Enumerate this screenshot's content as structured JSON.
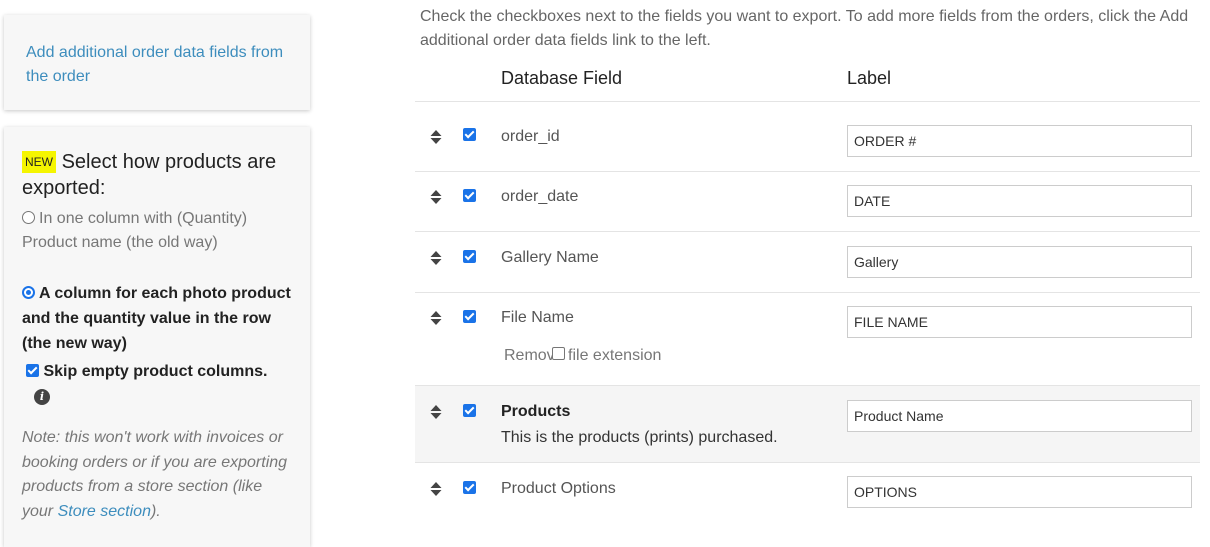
{
  "sidebar": {
    "links_panel": {
      "add_fields_link": "Add additional order data fields from the order"
    },
    "export_panel": {
      "badge": "NEW",
      "heading": "Select how products are exported:",
      "option_old": "In one column with (Quantity) Product name (the old way)",
      "option_new": "A column for each photo product and the quantity value in the row (the new way)",
      "skip_empty": "Skip empty product columns.",
      "note_prefix": "Note: this won't work with invoices or booking orders or if you are exporting products from a store section (like your ",
      "note_link": "Store section",
      "note_suffix": ")."
    }
  },
  "main": {
    "intro": "Check the checkboxes next to the fields you want to export. To add more fields from the orders, click the Add additional order data fields link to the left.",
    "columns": {
      "field": "Database Field",
      "label": "Label"
    },
    "rows": [
      {
        "field": "order_id",
        "label": "ORDER #"
      },
      {
        "field": "order_date",
        "label": "DATE"
      },
      {
        "field": "Gallery Name",
        "label": "Gallery"
      },
      {
        "field": "File Name",
        "label": "FILE NAME",
        "option": "Remove file extension"
      },
      {
        "field": "Products",
        "label": "Product Name",
        "description": "This is the products (prints) purchased."
      },
      {
        "field": "Product Options",
        "label": "OPTIONS"
      }
    ]
  },
  "colors": {
    "accent": "#1a73e8",
    "link": "#3d8dbd",
    "badge": "#f5f500"
  }
}
